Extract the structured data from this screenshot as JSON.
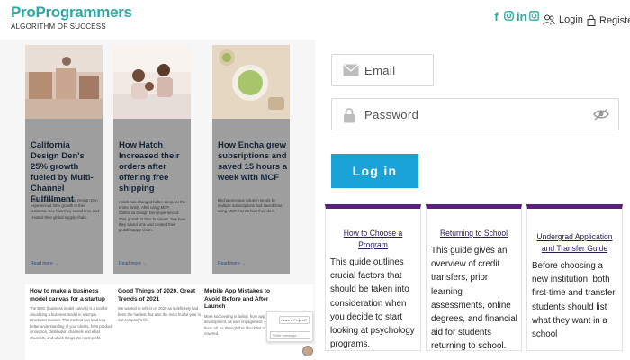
{
  "header": {
    "brand": "ProProgrammers",
    "tagline": "ALGORITHM OF SUCCESS",
    "social_icons": [
      "facebook-icon",
      "instagram-icon",
      "linkedin-icon",
      "whatsapp-icon"
    ],
    "login_label": "Login",
    "register_label": "Register",
    "accent_color": "#2fa7a0"
  },
  "blog_cards": [
    {
      "title": "California Design Den's 25% growth fueled by Multi-Channel Fulfillment",
      "desc": "After using MCF, California Design Den experienced 25% growth in their business. See how they saved time and created their global supply chain.",
      "more": "Read more →"
    },
    {
      "title": "How Hatch Increased their orders after offering free shipping",
      "desc": "Hatch has changed better sleep for the entire family. After using MCF, California Design Den experienced 25% growth in their business. See how they saved time and created their global supply chain.",
      "more": "Read more →"
    },
    {
      "title": "How Encha grew subsriptions and saved 15 hours a week with MCF",
      "desc": "Encha previous solution needs by multiple subscriptions and saved time using MCF. Here's how they do it.",
      "more": "Read more →"
    }
  ],
  "articles": [
    {
      "title": "How to make a business model canvas for a startup",
      "desc": "The BMC (business model canvas) is a tool for visualizing a business model in a simple, structured manner. This method can lead to a better understanding of your clients, from product innovation, distribution channels and what channels, and which things the most profit."
    },
    {
      "title": "Good Things of 2020. Great Trends of 2021",
      "desc": "We wanted to reflect on 2020 as it definitely had been the hardest, but also the most fruitful year in our company's life."
    },
    {
      "title": "Mobile App Mistakes to Avoid Before and After Launch",
      "desc": "More succeeding in failing, from app development, as user engagement -- the cause them all. As through this check-list of ones we covered."
    }
  ],
  "chat": {
    "question": "Have a Project?",
    "placeholder": "Write message..."
  },
  "login_form": {
    "email_placeholder": "Email",
    "password_placeholder": "Password",
    "button_label": "Log in",
    "button_color": "#1aa3d8"
  },
  "guides": [
    {
      "title": "How to Choose a Program",
      "body": "This guide outlines crucial factors that should be taken into consideration when you decide to start looking at psychology programs."
    },
    {
      "title": "Returning to School",
      "body": "This guide gives an overview of credit transfers, prior learning assessments, online degrees, and financial aid for students returning to school."
    },
    {
      "title": "Undergrad Application and Transfer Guide",
      "body": "Before choosing a new institution, both first-time and transfer students should list what they want in a school"
    }
  ],
  "guide_accent": "#5a1f80"
}
